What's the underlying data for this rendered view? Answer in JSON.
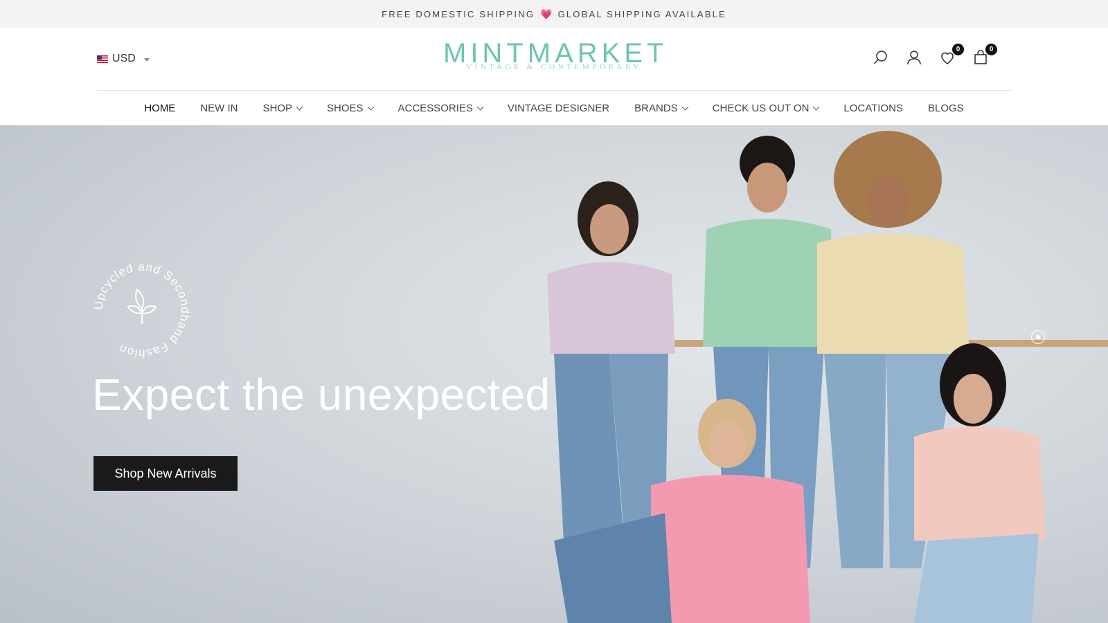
{
  "announcement": {
    "left": "FREE DOMESTIC SHIPPING",
    "heart": "💗",
    "right": "GLOBAL SHIPPING AVAILABLE"
  },
  "currency": {
    "code": "USD",
    "flag": "us-flag-icon"
  },
  "logo": {
    "main": "MINTMARKET",
    "sub": "VINTAGE & CONTEMPORARY"
  },
  "header_icons": {
    "wishlist_count": "0",
    "cart_count": "0"
  },
  "nav": [
    {
      "label": "HOME",
      "dropdown": false,
      "active": true
    },
    {
      "label": "NEW IN",
      "dropdown": false
    },
    {
      "label": "SHOP",
      "dropdown": true
    },
    {
      "label": "SHOES",
      "dropdown": true
    },
    {
      "label": "ACCESSORIES",
      "dropdown": true
    },
    {
      "label": "VINTAGE DESIGNER",
      "dropdown": false
    },
    {
      "label": "BRANDS",
      "dropdown": true
    },
    {
      "label": "CHECK US OUT ON",
      "dropdown": true
    },
    {
      "label": "LOCATIONS",
      "dropdown": false
    },
    {
      "label": "BLOGS",
      "dropdown": false
    }
  ],
  "hero": {
    "badge_text": "Upcycled and Secondhand Fashion",
    "title": "Expect the unexpected",
    "cta": "Shop New Arrivals"
  },
  "colors": {
    "brand": "#6cc5b0",
    "button": "#1a1a1a",
    "announce_bg": "#f3f3f3"
  }
}
